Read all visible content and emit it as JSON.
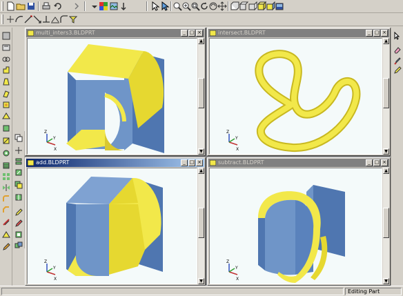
{
  "windows": [
    {
      "title": "multi_inters3.BLDPRT",
      "active": false
    },
    {
      "title": "intersect.BLDPRT",
      "active": false
    },
    {
      "title": "add.BLDPRT",
      "active": true
    },
    {
      "title": "subtract.BLDPRT",
      "active": false
    }
  ],
  "window_buttons": {
    "minimize": "_",
    "maximize": "□",
    "close": "×"
  },
  "axis": {
    "x": "X",
    "y": "Y",
    "z": "Z"
  },
  "status": {
    "mode": "Editing Part"
  },
  "colors": {
    "face_blue": "#6f95c8",
    "face_yellow": "#f2e84a",
    "viewport_bg": "#f4fafa",
    "active_title": "#0a246a"
  },
  "icons": {
    "top_row_1": [
      "new-icon",
      "open-icon",
      "save-icon",
      "print-icon",
      "undo-icon",
      "redo-icon",
      "color-icon",
      "render-icon",
      "select-icon",
      "pan-icon",
      "zoom-icon",
      "rotate-icon",
      "view-front-icon",
      "view-iso-icon",
      "shade-icon"
    ],
    "top_row_2": [
      "line-icon",
      "arc-icon",
      "dimension-icon",
      "constraint-icon",
      "trim-icon",
      "filter-icon"
    ]
  }
}
